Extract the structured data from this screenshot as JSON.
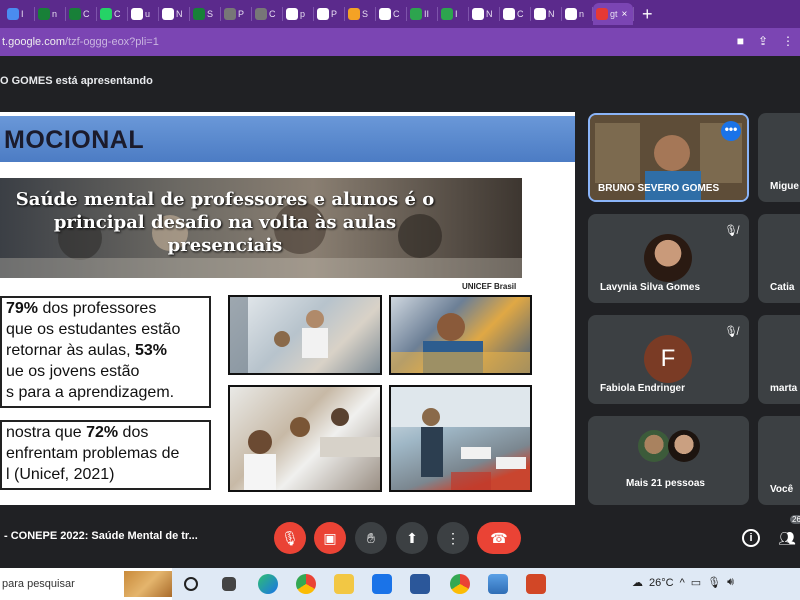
{
  "browser": {
    "tabs": [
      {
        "label": "I",
        "color": "#4a8cf0"
      },
      {
        "label": "n",
        "color": "#188038"
      },
      {
        "label": "C",
        "color": "#188038"
      },
      {
        "label": "C",
        "color": "#25d366"
      },
      {
        "label": "u",
        "color": "#fff"
      },
      {
        "label": "N",
        "color": "#fff"
      },
      {
        "label": "S",
        "color": "#188038"
      },
      {
        "label": "P",
        "color": "#777"
      },
      {
        "label": "C",
        "color": "#777"
      },
      {
        "label": "p",
        "color": "#fff"
      },
      {
        "label": "P",
        "color": "#fff"
      },
      {
        "label": "S",
        "color": "#f4a225"
      },
      {
        "label": "C",
        "color": "#fff"
      },
      {
        "label": "II",
        "color": "#2da44e"
      },
      {
        "label": "I",
        "color": "#2da44e"
      },
      {
        "label": "N",
        "color": "#fff"
      },
      {
        "label": "C",
        "color": "#fff"
      },
      {
        "label": "N",
        "color": "#fff"
      },
      {
        "label": "n",
        "color": "#fff"
      },
      {
        "label": "gt",
        "color": "#e53935"
      }
    ],
    "active_tab_close": "×",
    "new_tab": "+",
    "url_host": "t.google.com",
    "url_path": "/tzf-oggg-eox?pli=1"
  },
  "meet": {
    "presenter_text": "O GOMES está apresentando",
    "meeting_title": "- CONEPE 2022: Saúde Mental de tr...",
    "people_count": "26"
  },
  "slide": {
    "header": "MOCIONAL",
    "banner_text": "Saúde mental de professores e alunos é o principal desafio na volta às aulas presenciais",
    "banner_credit": "UNICEF Brasil",
    "box1": [
      {
        "pre": "",
        "bold": "79%",
        "post": " dos professores"
      },
      {
        "pre": "que os estudantes estão",
        "bold": "",
        "post": ""
      },
      {
        "pre": "retornar às aulas, ",
        "bold": "53%",
        "post": ""
      },
      {
        "pre": "ue os jovens estão",
        "bold": "",
        "post": ""
      },
      {
        "pre": "s para a aprendizagem.",
        "bold": "",
        "post": ""
      }
    ],
    "box2": [
      {
        "pre": "nostra que ",
        "bold": "72%",
        "post": " dos"
      },
      {
        "pre": "enfrentam problemas de",
        "bold": "",
        "post": ""
      },
      {
        "pre": "l (Unicef, 2021)",
        "bold": "",
        "post": ""
      }
    ]
  },
  "participants": [
    {
      "name": "BRUNO SEVERO GOMES",
      "type": "video"
    },
    {
      "name": "Migue",
      "type": "cut"
    },
    {
      "name": "Lavynia Silva Gomes",
      "type": "photo",
      "muted": true
    },
    {
      "name": "Catia",
      "type": "cut"
    },
    {
      "name": "Fabiola Endringer",
      "type": "initial",
      "initial": "F",
      "avatar_color": "#7a3b25",
      "muted": true
    },
    {
      "name": "marta",
      "type": "cut"
    },
    {
      "name": "Mais 21 pessoas",
      "type": "group"
    },
    {
      "name": "Você",
      "type": "cut"
    }
  ],
  "taskbar": {
    "search_placeholder": "para pesquisar",
    "temperature": "26°C"
  }
}
